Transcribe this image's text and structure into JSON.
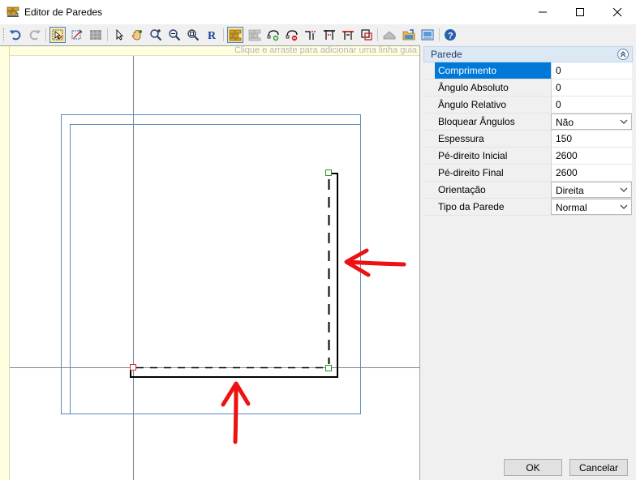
{
  "window": {
    "title": "Editor de Paredes",
    "icon": "wall-editor-icon",
    "minimize_icon": "minimize-icon",
    "maximize_icon": "maximize-icon",
    "close_icon": "close-icon"
  },
  "toolbar": {
    "buttons": [
      {
        "icon": "undo-icon",
        "active": false
      },
      {
        "icon": "redo-icon",
        "active": false
      },
      {
        "icon": "select-wall-icon",
        "active": true
      },
      {
        "icon": "draw-wall-icon",
        "active": false
      },
      {
        "icon": "grid-icon",
        "active": false
      },
      {
        "icon": "pointer-icon",
        "active": false
      },
      {
        "icon": "pan-hand-icon",
        "active": false
      },
      {
        "icon": "zoom-in-icon",
        "active": false
      },
      {
        "icon": "zoom-window-icon",
        "active": false
      },
      {
        "icon": "zoom-extents-icon",
        "active": false
      },
      {
        "icon": "redraw-icon",
        "active": false
      },
      {
        "icon": "wall-snap-icon",
        "active": true
      },
      {
        "icon": "wall-grid-icon",
        "active": false
      },
      {
        "icon": "add-node-icon",
        "active": false
      },
      {
        "icon": "remove-node-icon",
        "active": false
      },
      {
        "icon": "split-wall-icon",
        "active": false
      },
      {
        "icon": "align-top-icon",
        "active": false
      },
      {
        "icon": "align-center-icon",
        "active": false
      },
      {
        "icon": "offset-wall-icon",
        "active": false
      },
      {
        "icon": "roof-icon",
        "active": false
      },
      {
        "icon": "open-file-icon",
        "active": false
      },
      {
        "icon": "image-icon",
        "active": false
      },
      {
        "icon": "help-icon",
        "active": false
      }
    ]
  },
  "canvas": {
    "hint": "Clique e arraste para adicionar uma linha guia",
    "colors": {
      "guide": "#7a8a9a",
      "outline": "#5a8ab8",
      "wall": "#000000",
      "arrow": "#ee1111",
      "start_node": "#cc3333",
      "end_node": "#2f8f2f"
    }
  },
  "properties": {
    "category": "Parede",
    "rows": [
      {
        "label": "Comprimento",
        "value": "0",
        "dropdown": false
      },
      {
        "label": "Ângulo Absoluto",
        "value": "0",
        "dropdown": false
      },
      {
        "label": "Ângulo Relativo",
        "value": "0",
        "dropdown": false
      },
      {
        "label": "Bloquear Ângulos",
        "value": "Não",
        "dropdown": true
      },
      {
        "label": "Espessura",
        "value": "150",
        "dropdown": false
      },
      {
        "label": "Pé-direito Inicial",
        "value": "2600",
        "dropdown": false
      },
      {
        "label": "Pé-direito Final",
        "value": "2600",
        "dropdown": false
      },
      {
        "label": "Orientação",
        "value": "Direita",
        "dropdown": true
      },
      {
        "label": "Tipo da Parede",
        "value": "Normal",
        "dropdown": true
      }
    ]
  },
  "buttons": {
    "ok": "OK",
    "cancel": "Cancelar"
  }
}
